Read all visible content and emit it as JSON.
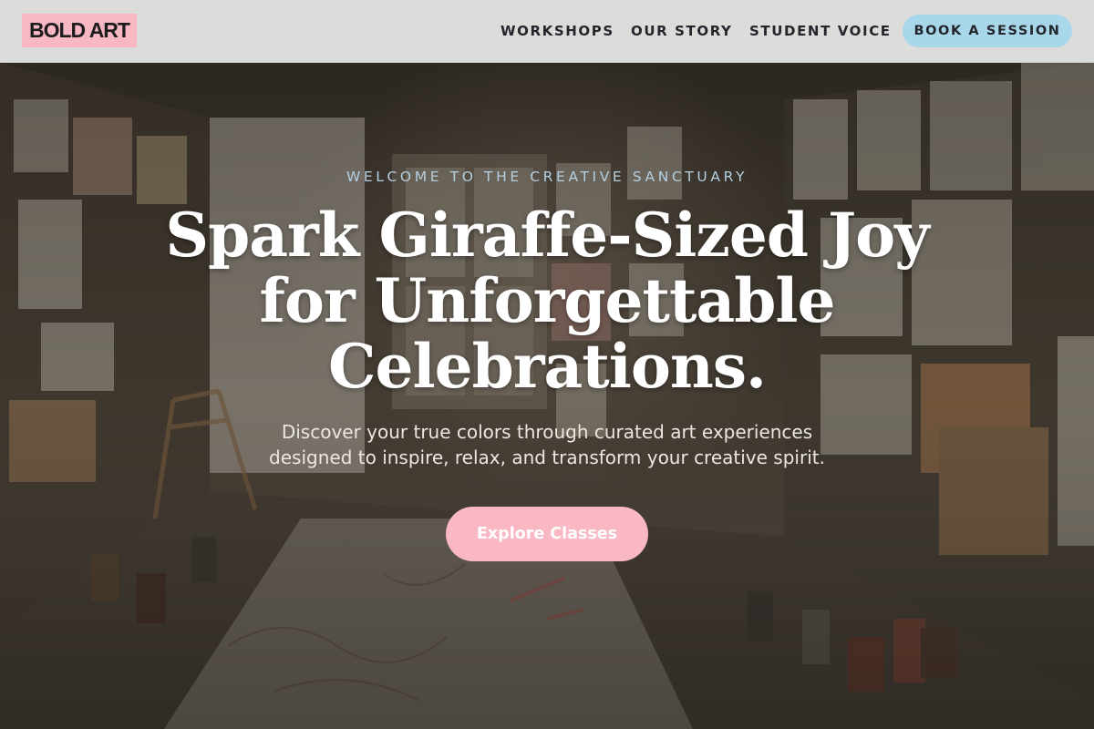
{
  "header": {
    "logo": "BOLD ART",
    "nav": [
      {
        "label": "WORKSHOPS"
      },
      {
        "label": "OUR STORY"
      },
      {
        "label": "STUDENT VOICE"
      }
    ],
    "book_button": "BOOK A SESSION"
  },
  "hero": {
    "eyebrow": "WELCOME TO THE CREATIVE SANCTUARY",
    "headline_lines": [
      "Spark Giraffe-Sized Joy",
      "for Unforgettable",
      "Celebrations."
    ],
    "subtext_lines": [
      "Discover your true colors through curated art experiences",
      "designed to inspire, relax, and transform your creative spirit."
    ],
    "cta": "Explore Classes",
    "background_image": "art studio room with paintings on walls and paper on floor"
  },
  "colors": {
    "logo_bg": "#f7b7c3",
    "book_button_bg": "#a9d7ea",
    "cta_bg": "#f9b8c3",
    "eyebrow": "#b4cfe0",
    "header_bg": "#dcdcda"
  }
}
